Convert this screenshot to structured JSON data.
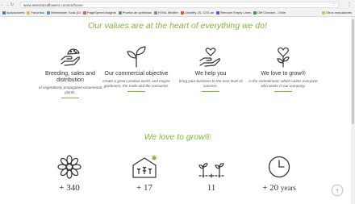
{
  "browser": {
    "url": "www.selectacutflowers.com/en/home",
    "bookmarks": [
      {
        "label": "Aplicaciones",
        "color": "#4a7bd0"
      },
      {
        "label": "Favoritos",
        "color": "#e8b84a"
      },
      {
        "label": "Webmaster Tools (Di",
        "color": "#5a8de0"
      },
      {
        "label": "PageSpeed Insights",
        "color": "#e05a4a"
      },
      {
        "label": "Prueba de optimizac",
        "color": "#4aa85a"
      },
      {
        "label": "HTML Minifier",
        "color": "#888888"
      },
      {
        "label": "Uncritify JS, CSS an",
        "color": "#d85a2a"
      },
      {
        "label": "Remove Empty Lines",
        "color": "#5a5ad0"
      },
      {
        "label": "Diff Checker - Onlin",
        "color": "#3a9a3a"
      }
    ],
    "other_bookmarks": "Otros marcadores"
  },
  "values_section": {
    "headline": "Our values are at the heart of everything we do!",
    "items": [
      {
        "icon": "hand-soil-icon",
        "title": "Breeding, sales and distribution",
        "desc": "of vegetatively propagated ornamental plants."
      },
      {
        "icon": "sprout-icon",
        "title": "Our commercial objective",
        "desc": "create a green product world, and inspire gardeners, the trade and the consumer."
      },
      {
        "icon": "hand-heart-icon",
        "title": "We help you",
        "desc": "bring your business to the next level of success."
      },
      {
        "icon": "heart-flower-icon",
        "title": "We love to grow®",
        "desc": "is the commitment, which unites everyone who works in our company."
      }
    ]
  },
  "stats_section": {
    "headline": "We love to grow®",
    "items": [
      {
        "icon": "flower-icon",
        "value": "+ 340",
        "suffix": ""
      },
      {
        "icon": "greenhouse-icon",
        "value": "+ 17",
        "suffix": ""
      },
      {
        "icon": "seedlings-icon",
        "value": "11",
        "suffix": ""
      },
      {
        "icon": "clock-icon",
        "value": "+ 20",
        "suffix": "years"
      }
    ]
  },
  "colors": {
    "accent": "#7fb83a",
    "icon": "#333333"
  }
}
